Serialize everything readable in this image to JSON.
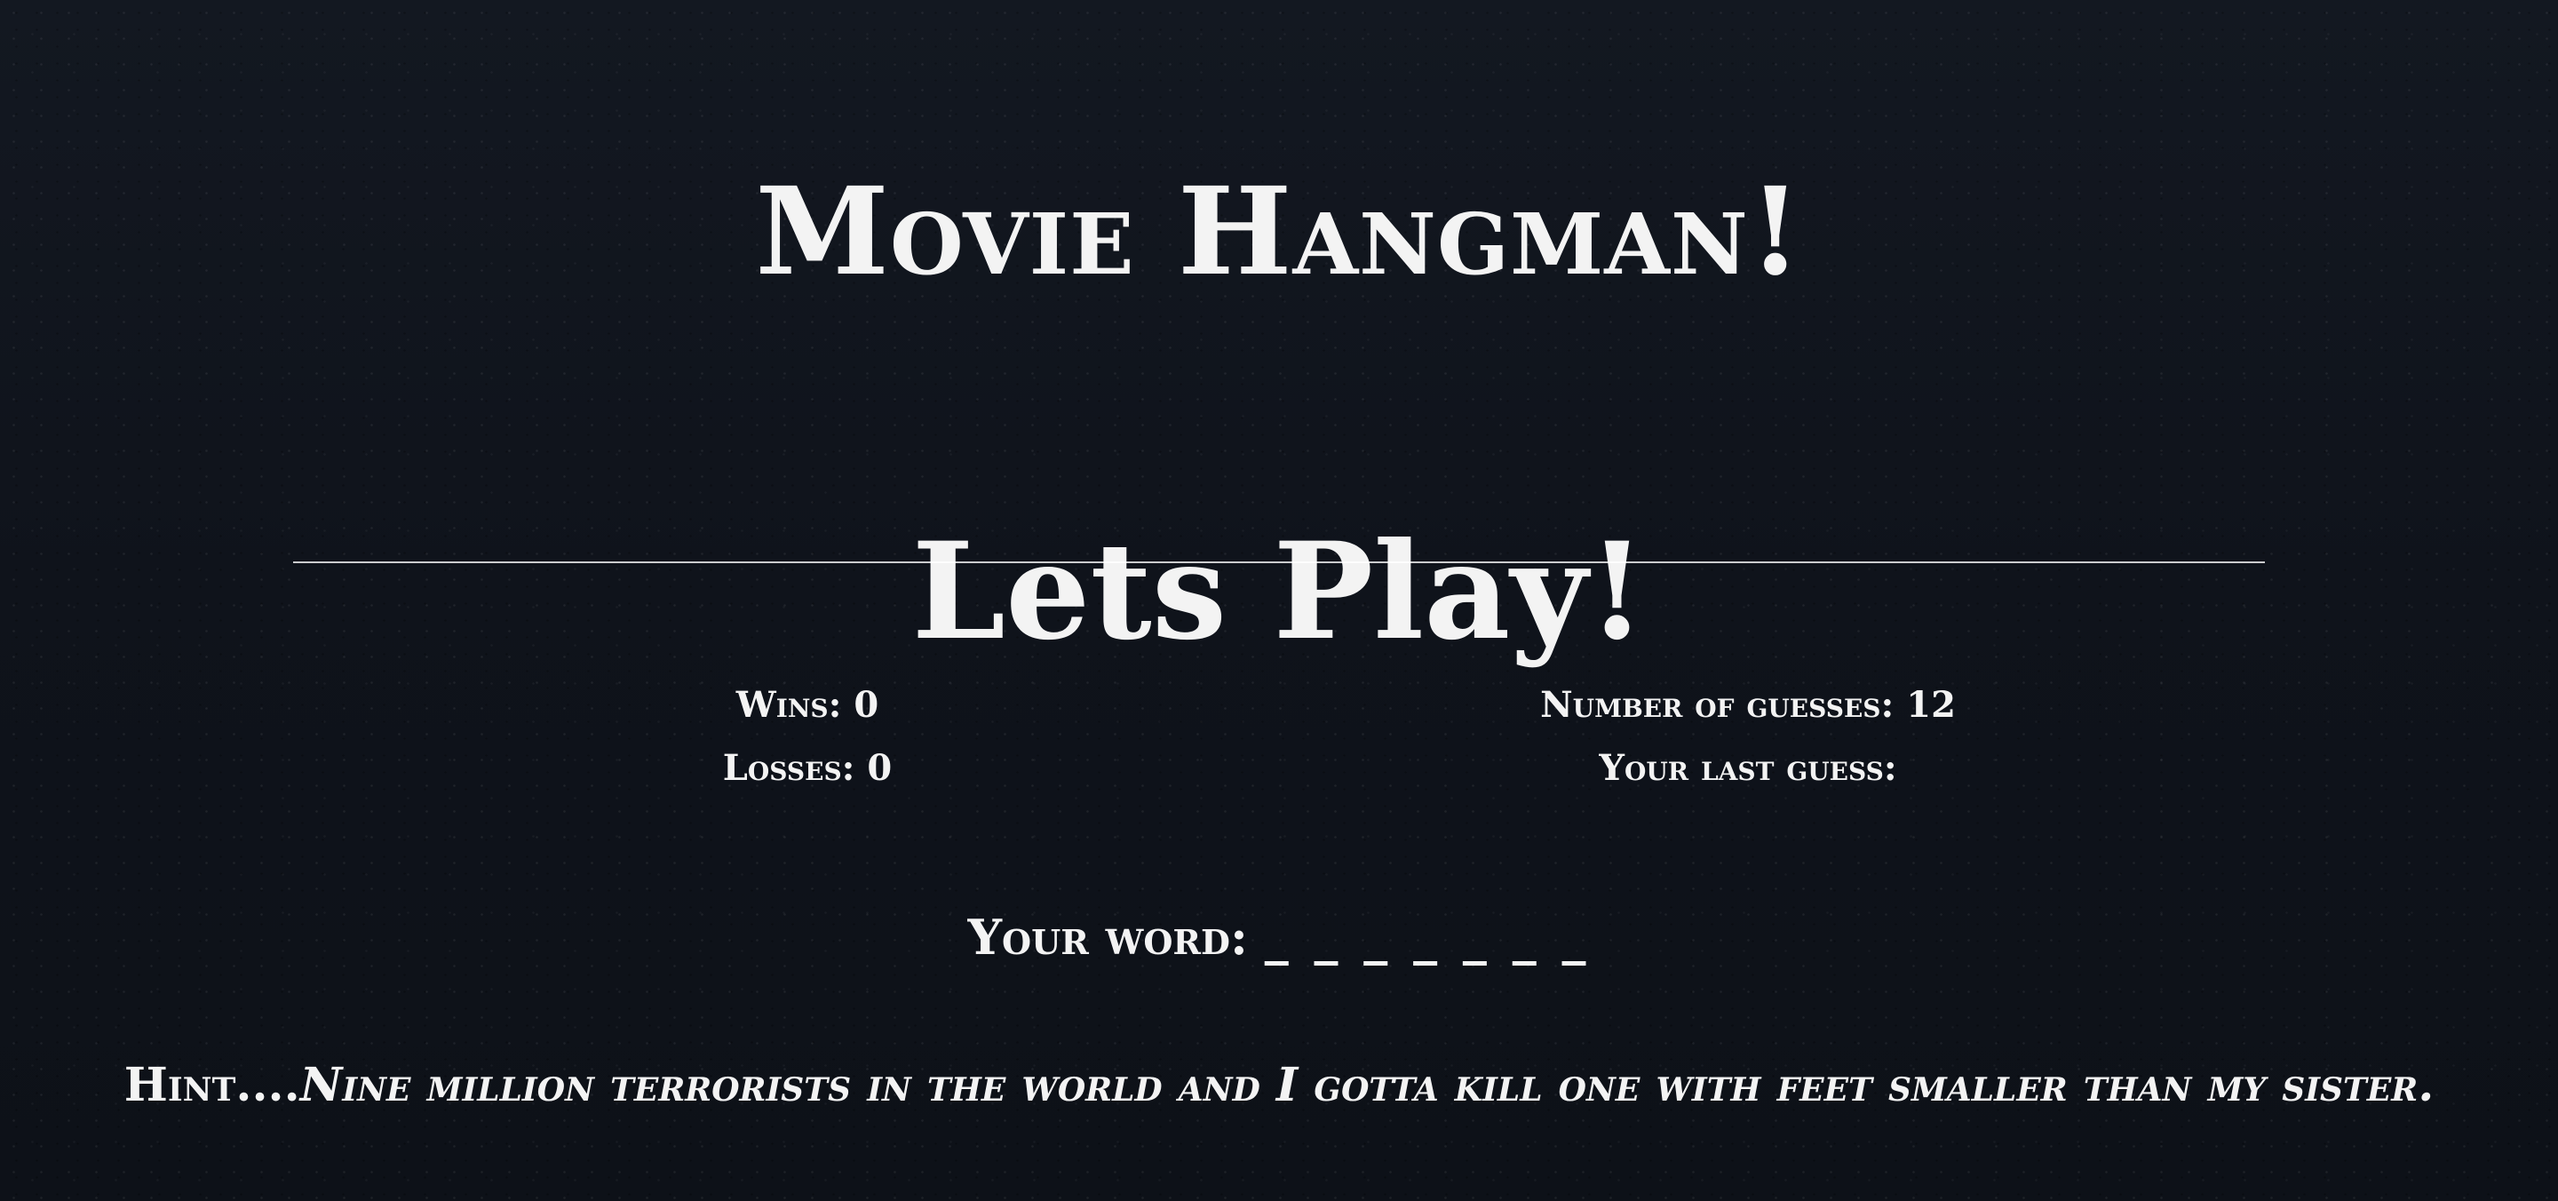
{
  "game": {
    "title": "Movie Hangman!",
    "subtitle": "Lets Play!"
  },
  "stats": {
    "wins_label": "Wins:",
    "wins_value": "0",
    "losses_label": "Losses:",
    "losses_value": "0",
    "guesses_label": "Number of guesses:",
    "guesses_value": "12",
    "last_guess_label": "Your last guess:",
    "last_guess_value": ""
  },
  "word": {
    "label": "Your word:",
    "display": "_ _ _ _ _ _ _"
  },
  "hint": {
    "label": "Hint....",
    "text": "Nine million terrorists in the world and I gotta kill one with feet smaller than my sister."
  }
}
